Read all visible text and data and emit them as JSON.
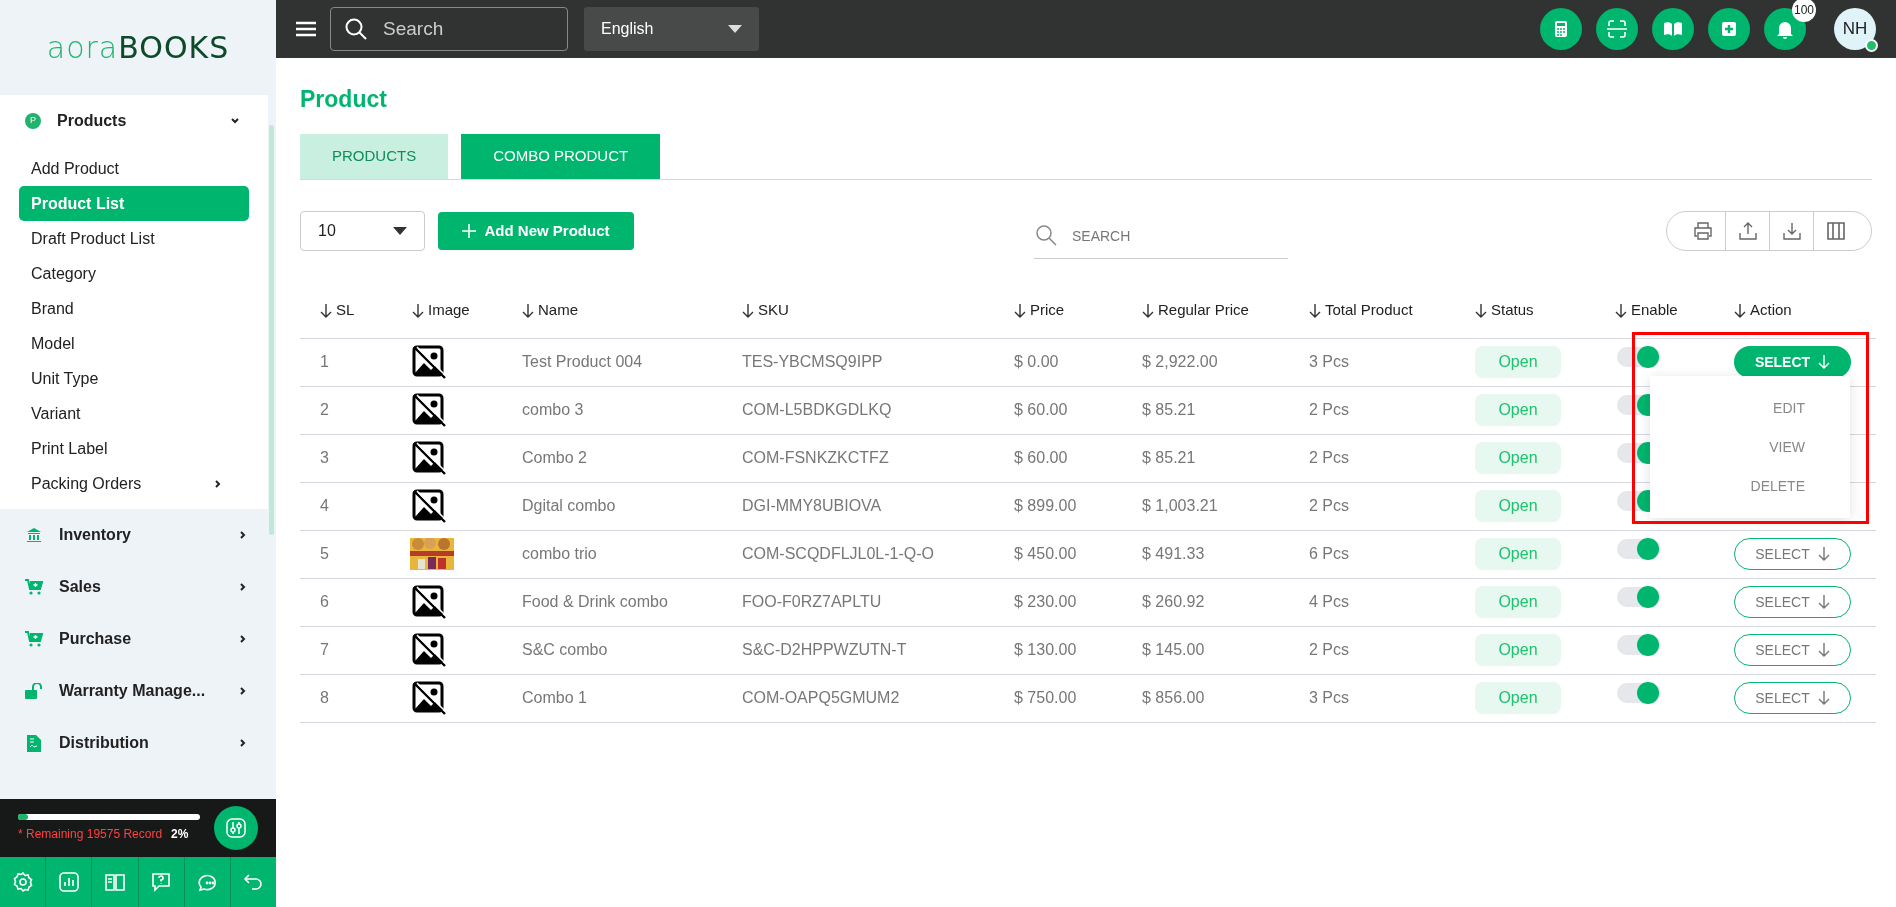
{
  "sidebar": {
    "logo": {
      "light": "aora",
      "dark": "BOOKS"
    },
    "sections": [
      {
        "label": "Products",
        "badge_letter": "P",
        "expanded": true,
        "children": [
          {
            "label": "Add Product",
            "selected": false,
            "has_submenu": false
          },
          {
            "label": "Product List",
            "selected": true,
            "has_submenu": false
          },
          {
            "label": "Draft Product List",
            "selected": false,
            "has_submenu": false
          },
          {
            "label": "Category",
            "selected": false,
            "has_submenu": false
          },
          {
            "label": "Brand",
            "selected": false,
            "has_submenu": false
          },
          {
            "label": "Model",
            "selected": false,
            "has_submenu": false
          },
          {
            "label": "Unit Type",
            "selected": false,
            "has_submenu": false
          },
          {
            "label": "Variant",
            "selected": false,
            "has_submenu": false
          },
          {
            "label": "Print Label",
            "selected": false,
            "has_submenu": false
          },
          {
            "label": "Packing Orders",
            "selected": false,
            "has_submenu": true
          }
        ]
      },
      {
        "label": "Inventory",
        "expanded": false
      },
      {
        "label": "Sales",
        "expanded": false
      },
      {
        "label": "Purchase",
        "expanded": false
      },
      {
        "label": "Warranty Manage...",
        "expanded": false
      },
      {
        "label": "Distribution",
        "expanded": false
      }
    ],
    "usage": {
      "level": 0.02,
      "note": "* Remaining 19575 Record",
      "percent": "2%"
    }
  },
  "header": {
    "search": {
      "placeholder": "Search"
    },
    "language": "English",
    "notification_count": "100",
    "avatar": {
      "initials": "NH",
      "online": true
    }
  },
  "page": {
    "title": "Product",
    "tabs": [
      {
        "label": "PRODUCTS",
        "selected": false
      },
      {
        "label": "COMBO PRODUCT",
        "selected": true
      }
    ],
    "page_size": "10",
    "add_button": "Add New Product",
    "search": {
      "placeholder": "SEARCH"
    },
    "table": {
      "columns": [
        "SL",
        "Image",
        "Name",
        "SKU",
        "Price",
        "Regular Price",
        "Total Product",
        "Status",
        "Enable",
        "Action"
      ],
      "rows": [
        {
          "sl": "1",
          "has_picture": false,
          "name": "Test Product 004",
          "sku": "TES-YBCMSQ9IPP",
          "price": "$ 0.00",
          "regular_price": "$ 2,922.00",
          "total": "3 Pcs",
          "status": "Open",
          "enabled": true,
          "action": {
            "label": "SELECT",
            "selected": true
          }
        },
        {
          "sl": "2",
          "has_picture": false,
          "name": "combo 3",
          "sku": "COM-L5BDKGDLKQ",
          "price": "$ 60.00",
          "regular_price": "$ 85.21",
          "total": "2 Pcs",
          "status": "Open",
          "enabled": true
        },
        {
          "sl": "3",
          "has_picture": false,
          "name": "Combo 2",
          "sku": "COM-FSNKZKCTFZ",
          "price": "$ 60.00",
          "regular_price": "$ 85.21",
          "total": "2 Pcs",
          "status": "Open",
          "enabled": true
        },
        {
          "sl": "4",
          "has_picture": false,
          "name": "Dgital combo",
          "sku": "DGI-MMY8UBIOVA",
          "price": "$ 899.00",
          "regular_price": "$ 1,003.21",
          "total": "2 Pcs",
          "status": "Open",
          "enabled": true
        },
        {
          "sl": "5",
          "has_picture": true,
          "name": "combo trio",
          "sku": "COM-SCQDFLJL0L-1-Q-O",
          "price": "$ 450.00",
          "regular_price": "$ 491.33",
          "total": "6 Pcs",
          "status": "Open",
          "enabled": true,
          "action": {
            "label": "SELECT",
            "selected": false
          }
        },
        {
          "sl": "6",
          "has_picture": false,
          "name": "Food & Drink combo",
          "sku": "FOO-F0RZ7APLTU",
          "price": "$ 230.00",
          "regular_price": "$ 260.92",
          "total": "4 Pcs",
          "status": "Open",
          "enabled": true,
          "action": {
            "label": "SELECT",
            "selected": false
          }
        },
        {
          "sl": "7",
          "has_picture": false,
          "name": "S&C combo",
          "sku": "S&C-D2HPPWZUTN-T",
          "price": "$ 130.00",
          "regular_price": "$ 145.00",
          "total": "2 Pcs",
          "status": "Open",
          "enabled": true,
          "action": {
            "label": "SELECT",
            "selected": false
          }
        },
        {
          "sl": "8",
          "has_picture": false,
          "name": "Combo 1",
          "sku": "COM-OAPQ5GMUM2",
          "price": "$ 750.00",
          "regular_price": "$ 856.00",
          "total": "3 Pcs",
          "status": "Open",
          "enabled": true,
          "action": {
            "label": "SELECT",
            "selected": false
          }
        }
      ]
    },
    "action_menu": {
      "items": [
        "EDIT",
        "VIEW",
        "DELETE"
      ],
      "highlighted": true
    }
  }
}
